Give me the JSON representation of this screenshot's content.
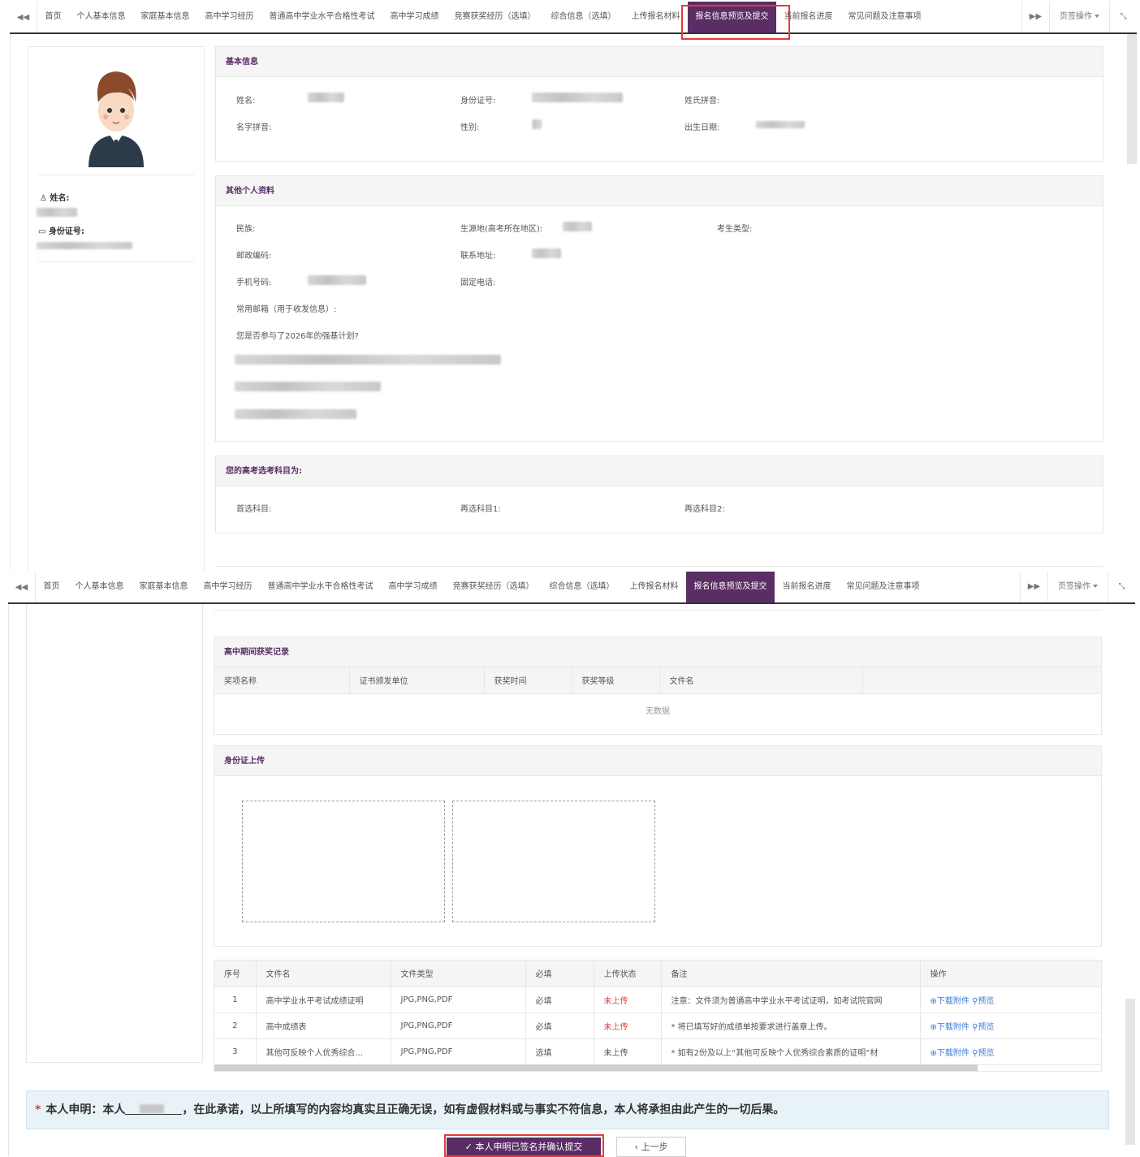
{
  "tabs": [
    "首页",
    "个人基本信息",
    "家庭基本信息",
    "高中学习经历",
    "普通高中学业水平合格性考试",
    "高中学习成绩",
    "竞赛获奖经历（选填）",
    "综合信息（选填）",
    "上传报名材料",
    "报名信息预览及提交",
    "当前报名进度",
    "常见问题及注意事项"
  ],
  "active_tab": "报名信息预览及提交",
  "tabbar": {
    "page_ops": "页签操作"
  },
  "left_card": {
    "name_label": "姓名:",
    "id_label": "身份证号:"
  },
  "basic": {
    "title": "基本信息",
    "name": "姓名:",
    "id": "身份证号:",
    "surname_pinyin": "姓氏拼音:",
    "given_pinyin": "名字拼音:",
    "gender": "性别:",
    "birth": "出生日期:"
  },
  "other": {
    "title": "其他个人资料",
    "ethnicity": "民族:",
    "origin": "生源地(高考所在地区):",
    "type": "考生类型:",
    "postcode": "邮政编码:",
    "address": "联系地址:",
    "mobile": "手机号码:",
    "phone": "固定电话:",
    "email": "常用邮箱（用于收发信息）:",
    "plan_q": "您是否参与了2026年的强基计划?"
  },
  "subjects": {
    "title": "您的高考选考科目为:",
    "first": "首选科目:",
    "second1": "再选科目1:",
    "second2": "再选科目2:"
  },
  "awards": {
    "title": "高中期间获奖记录",
    "columns": [
      "奖项名称",
      "证书颁发单位",
      "获奖时间",
      "获奖等级",
      "文件名"
    ],
    "empty": "无数据"
  },
  "id_upload": {
    "title": "身份证上传"
  },
  "files": {
    "columns": [
      "序号",
      "文件名",
      "文件类型",
      "必填",
      "上传状态",
      "备注",
      "操作"
    ],
    "rows": [
      {
        "no": "1",
        "name": "高中学业水平考试成绩证明",
        "type": "JPG,PNG,PDF",
        "req": "必填",
        "status": "未上传",
        "note": "注意：文件须为普通高中学业水平考试证明，如考试院官网",
        "download": "下载附件",
        "preview": "预览"
      },
      {
        "no": "2",
        "name": "高中成绩表",
        "type": "JPG,PNG,PDF",
        "req": "必填",
        "status": "未上传",
        "note": "* 将已填写好的成绩单按要求进行盖章上传。",
        "download": "下载附件",
        "preview": "预览"
      },
      {
        "no": "3",
        "name": "其他可反映个人优秀综合...",
        "type": "JPG,PNG,PDF",
        "req": "选填",
        "status": "未上传",
        "note": "* 如有2份及以上“其他可反映个人优秀综合素质的证明”材",
        "download": "下载附件",
        "preview": "预览"
      }
    ]
  },
  "declaration": {
    "prefix": "本人申明：本人",
    "suffix": "，在此承诺，以上所填写的内容均真实且正确无误，如有虚假材料或与事实不符信息，本人将承担由此产生的一切后果。"
  },
  "buttons": {
    "submit": "本人申明已签名并确认提交",
    "back": "上一步"
  },
  "colors": {
    "accent": "#5a2d65",
    "highlight": "#e23b3b",
    "link": "#3b7bd6"
  }
}
